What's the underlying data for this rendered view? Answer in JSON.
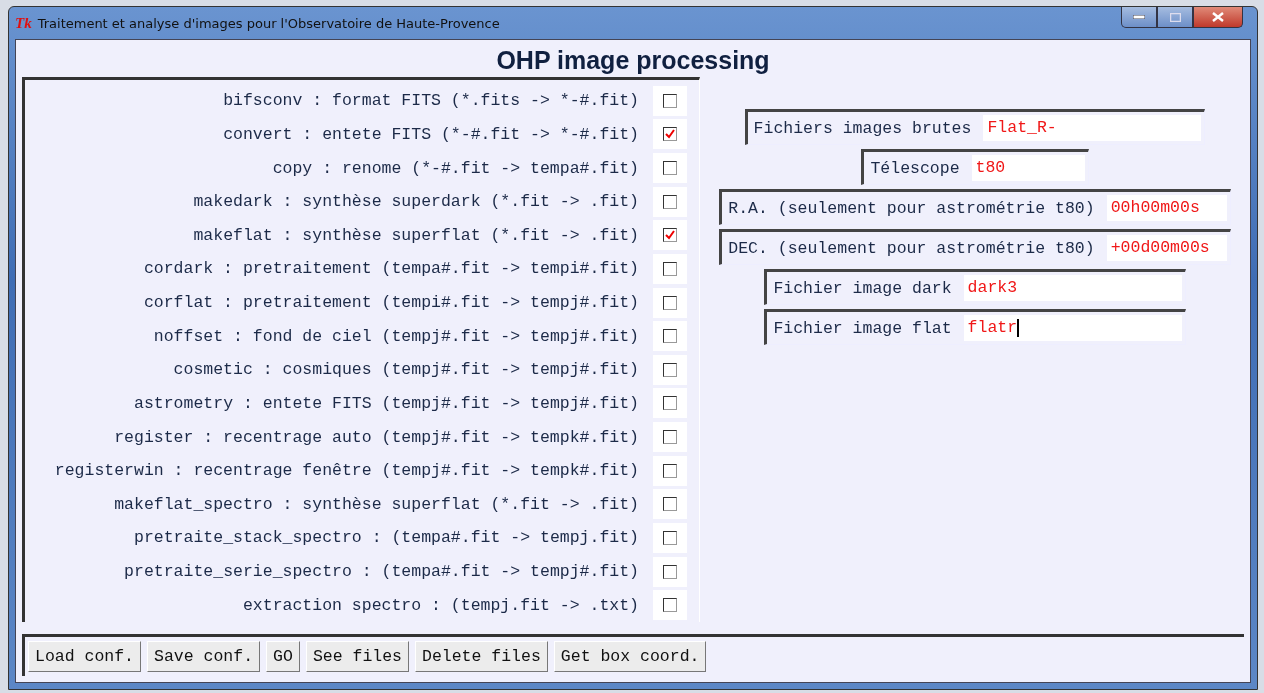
{
  "window": {
    "icon_text": "Tk",
    "title": "Traitement et analyse d'images pour l'Observatoire de Haute-Provence"
  },
  "heading": "OHP image processing",
  "tasks": [
    {
      "label": "bifsconv : format FITS (*.fits -> *-#.fit)",
      "checked": false
    },
    {
      "label": "convert : entete FITS (*-#.fit -> *-#.fit)",
      "checked": true
    },
    {
      "label": "copy : renome (*-#.fit -> tempa#.fit)",
      "checked": false
    },
    {
      "label": "makedark : synthèse superdark (*.fit -> .fit)",
      "checked": false
    },
    {
      "label": "makeflat : synthèse superflat (*.fit -> .fit)",
      "checked": true
    },
    {
      "label": "cordark : pretraitement (tempa#.fit -> tempi#.fit)",
      "checked": false
    },
    {
      "label": "corflat : pretraitement (tempi#.fit -> tempj#.fit)",
      "checked": false
    },
    {
      "label": "noffset : fond de ciel (tempj#.fit -> tempj#.fit)",
      "checked": false
    },
    {
      "label": "cosmetic : cosmiques (tempj#.fit -> tempj#.fit)",
      "checked": false
    },
    {
      "label": "astrometry : entete FITS (tempj#.fit -> tempj#.fit)",
      "checked": false
    },
    {
      "label": "register : recentrage auto (tempj#.fit -> tempk#.fit)",
      "checked": false
    },
    {
      "label": "registerwin : recentrage fenêtre (tempj#.fit -> tempk#.fit)",
      "checked": false
    },
    {
      "label": "makeflat_spectro : synthèse superflat (*.fit -> .fit)",
      "checked": false
    },
    {
      "label": "pretraite_stack_spectro : (tempa#.fit -> tempj.fit)",
      "checked": false
    },
    {
      "label": "pretraite_serie_spectro : (tempa#.fit -> tempj#.fit)",
      "checked": false
    },
    {
      "label": "extraction spectro : (tempj.fit -> .txt)",
      "checked": false
    }
  ],
  "fields": [
    {
      "label": "Fichiers images brutes",
      "value": "Flat_R-",
      "focused": false
    },
    {
      "label": "Télescope",
      "value": "t80",
      "focused": false
    },
    {
      "label": "R.A. (seulement pour astrométrie t80)",
      "value": "00h00m00s",
      "focused": false
    },
    {
      "label": "DEC. (seulement pour astrométrie t80)",
      "value": "+00d00m00s",
      "focused": false
    },
    {
      "label": "Fichier image dark",
      "value": "dark3",
      "focused": false
    },
    {
      "label": "Fichier image flat",
      "value": "flatr",
      "focused": true
    }
  ],
  "buttons": [
    "Load conf.",
    "Save conf.",
    "GO",
    "See files",
    "Delete files",
    "Get box coord."
  ]
}
